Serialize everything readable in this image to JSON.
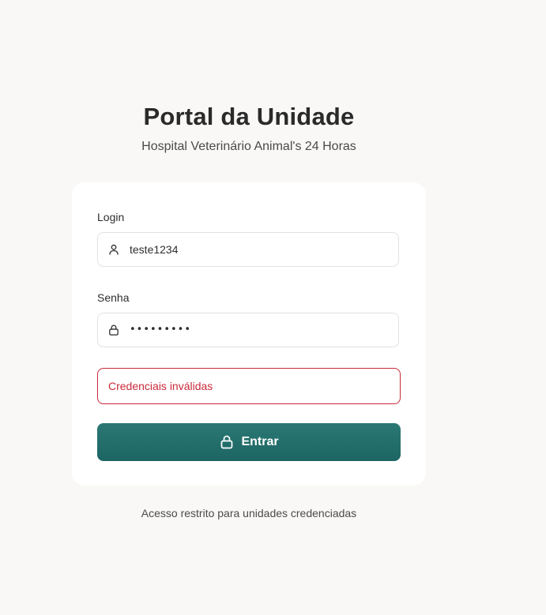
{
  "header": {
    "title": "Portal da Unidade",
    "subtitle": "Hospital Veterinário Animal's 24 Horas"
  },
  "form": {
    "login_label": "Login",
    "login_value": "teste1234",
    "login_icon": "user-icon",
    "senha_label": "Senha",
    "senha_value": "•••••••••",
    "senha_icon": "lock-icon",
    "error_message": "Credenciais inválidas",
    "submit_label": "Entrar",
    "submit_icon": "lock-icon"
  },
  "footer": {
    "note": "Acesso restrito para unidades credenciadas"
  },
  "colors": {
    "page_background": "#f9f8f6",
    "card_background": "#ffffff",
    "accent": "#1f6b68",
    "error": "#c92a3a"
  }
}
